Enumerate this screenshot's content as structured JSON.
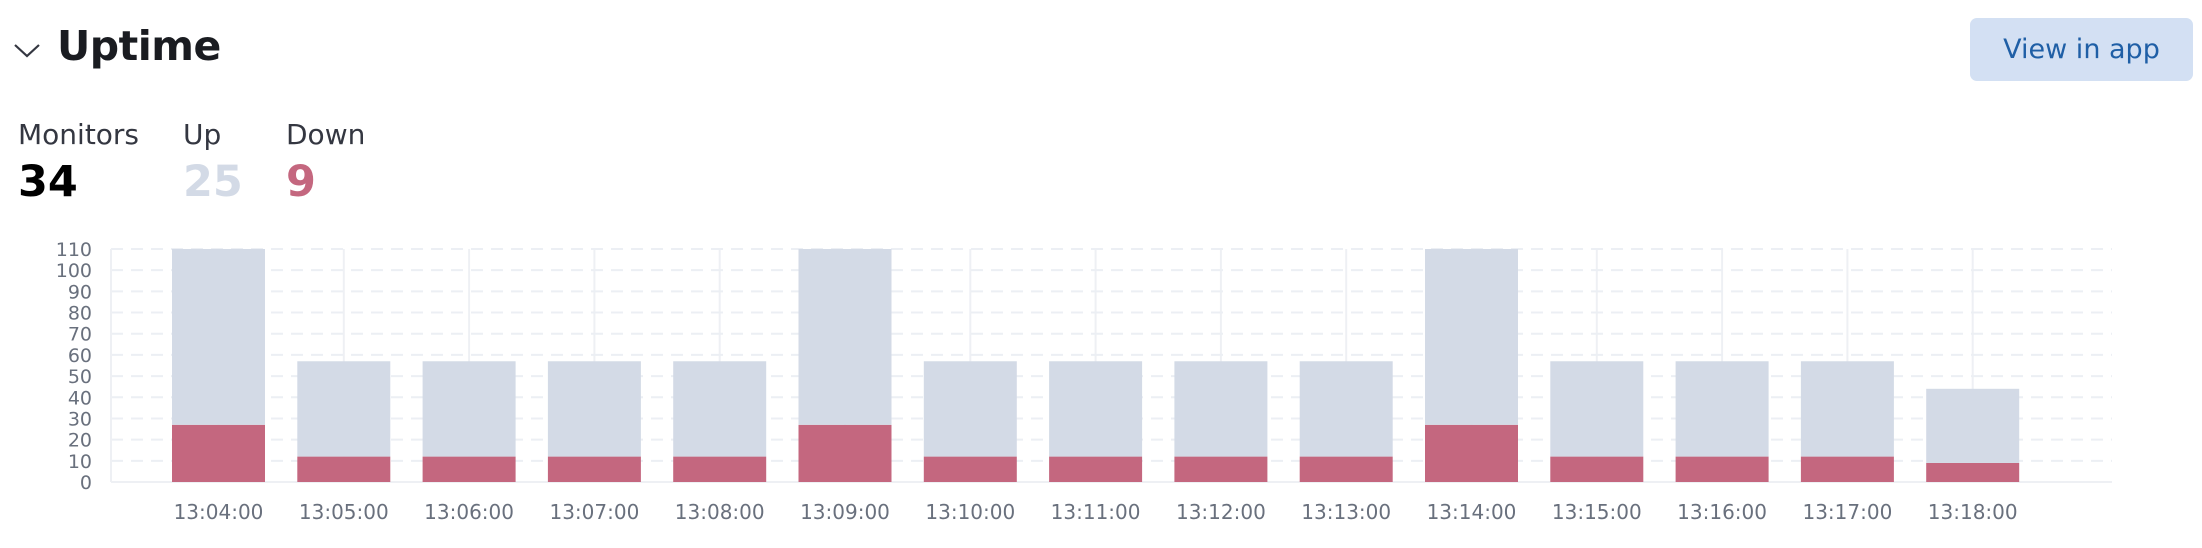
{
  "header": {
    "title": "Uptime",
    "collapse_icon": "chevron-down-icon",
    "view_button_label": "View in app"
  },
  "stats": {
    "monitors": {
      "label": "Monitors",
      "value": "34"
    },
    "up": {
      "label": "Up",
      "value": "25",
      "color": "#d3dae6"
    },
    "down": {
      "label": "Down",
      "value": "9",
      "color": "#c4677f"
    }
  },
  "colors": {
    "up": "#d3dae6",
    "down": "#c4677f",
    "button_bg": "#d3e0f3",
    "button_text": "#1f5fa6"
  },
  "chart_data": {
    "type": "bar",
    "stacked": true,
    "title": "",
    "xlabel": "",
    "ylabel": "",
    "ylim": [
      0,
      110
    ],
    "yticks": [
      0,
      10,
      20,
      30,
      40,
      50,
      60,
      70,
      80,
      90,
      100,
      110
    ],
    "grid": true,
    "legend": "none",
    "categories": [
      "13:04:00",
      "13:05:00",
      "13:06:00",
      "13:07:00",
      "13:08:00",
      "13:09:00",
      "13:10:00",
      "13:11:00",
      "13:12:00",
      "13:13:00",
      "13:14:00",
      "13:15:00",
      "13:16:00",
      "13:17:00",
      "13:18:00"
    ],
    "series": [
      {
        "name": "Down",
        "color": "#c4677f",
        "values": [
          27,
          12,
          12,
          12,
          12,
          27,
          12,
          12,
          12,
          12,
          27,
          12,
          12,
          12,
          9
        ]
      },
      {
        "name": "Up",
        "color": "#d3dae6",
        "values": [
          83,
          45,
          45,
          45,
          45,
          83,
          45,
          45,
          45,
          45,
          83,
          45,
          45,
          45,
          35
        ]
      }
    ],
    "note": "Bars at 13:04, 13:09, 13:14 are clipped at the 110 axis maximum"
  }
}
